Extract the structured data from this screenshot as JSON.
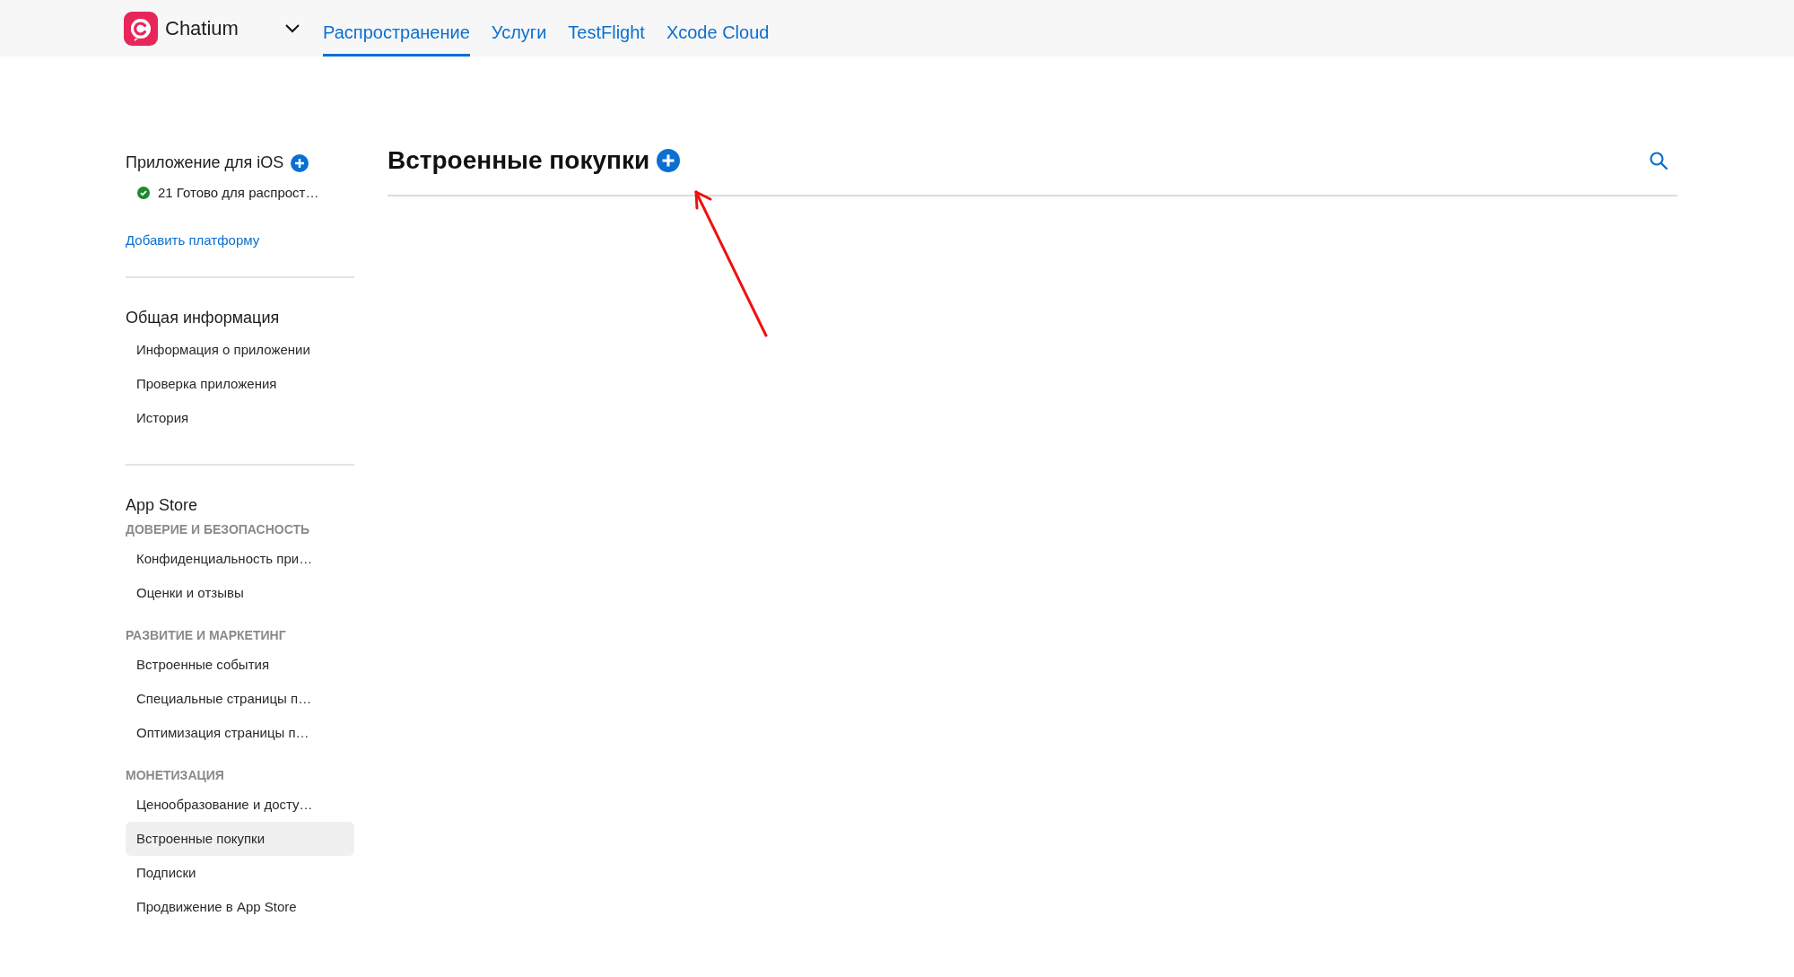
{
  "top_bar": {
    "app_name": "Chatium",
    "tabs": [
      {
        "label": "Распространение",
        "selected": true
      },
      {
        "label": "Услуги",
        "selected": false
      },
      {
        "label": "TestFlight",
        "selected": false
      },
      {
        "label": "Xcode Cloud",
        "selected": false
      }
    ]
  },
  "sidebar": {
    "platform": {
      "title": "Приложение для iOS",
      "status": "21 Готово для распрост…"
    },
    "add_platform_link": "Добавить платформу",
    "groups": [
      {
        "title": "Общая информация",
        "sections": [
          {
            "items": [
              {
                "label": "Информация о приложении",
                "selected": false
              },
              {
                "label": "Проверка приложения",
                "selected": false
              },
              {
                "label": "История",
                "selected": false
              }
            ]
          }
        ]
      },
      {
        "title": "App Store",
        "sections": [
          {
            "label": "ДОВЕРИЕ И БЕЗОПАСНОСТЬ",
            "items": [
              {
                "label": "Конфиденциальность при…",
                "selected": false
              },
              {
                "label": "Оценки и отзывы",
                "selected": false
              }
            ]
          },
          {
            "label": "РАЗВИТИЕ И МАРКЕТИНГ",
            "items": [
              {
                "label": "Встроенные события",
                "selected": false
              },
              {
                "label": "Специальные страницы п…",
                "selected": false
              },
              {
                "label": "Оптимизация страницы п…",
                "selected": false
              }
            ]
          },
          {
            "label": "МОНЕТИЗАЦИЯ",
            "items": [
              {
                "label": "Ценообразование и досту…",
                "selected": false
              },
              {
                "label": "Встроенные покупки",
                "selected": true
              },
              {
                "label": "Подписки",
                "selected": false
              },
              {
                "label": "Продвижение в App Store",
                "selected": false
              }
            ]
          }
        ]
      }
    ]
  },
  "main": {
    "title": "Встроенные покупки"
  }
}
